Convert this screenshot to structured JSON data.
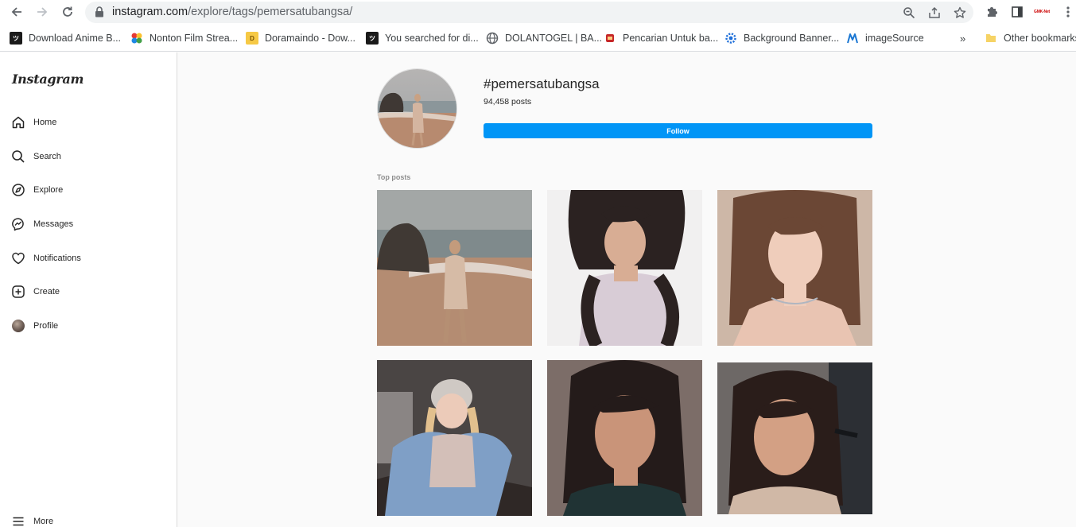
{
  "browser": {
    "url_host": "instagram.com",
    "url_path": "/explore/tags/pemersatubangsa/",
    "extension_badge": "GMK-Net",
    "bookmarks": [
      {
        "label": "Download Anime B...",
        "icon": "dark-page-icon"
      },
      {
        "label": "Nonton Film Strea...",
        "icon": "pinwheel-icon"
      },
      {
        "label": "Doramaindo - Dow...",
        "icon": "d-letter-icon",
        "icon_text": "D"
      },
      {
        "label": "You searched for di...",
        "icon": "dark-page-icon"
      },
      {
        "label": "DOLANTOGEL | BA...",
        "icon": "globe-icon"
      },
      {
        "label": "Pencarian Untuk ba...",
        "icon": "red-box-icon"
      },
      {
        "label": "Background Banner...",
        "icon": "gear-blue-icon"
      },
      {
        "label": "imageSource",
        "icon": "m-logo-icon"
      }
    ],
    "other_bookmarks": "Other bookmarks"
  },
  "sidebar": {
    "logo": "Instagram",
    "items": [
      {
        "label": "Home",
        "icon": "home-icon"
      },
      {
        "label": "Search",
        "icon": "search-icon"
      },
      {
        "label": "Explore",
        "icon": "compass-icon"
      },
      {
        "label": "Messages",
        "icon": "messenger-icon"
      },
      {
        "label": "Notifications",
        "icon": "heart-icon"
      },
      {
        "label": "Create",
        "icon": "plus-square-icon"
      },
      {
        "label": "Profile",
        "icon": "avatar"
      }
    ],
    "more": "More"
  },
  "tag": {
    "title": "#pemersatubangsa",
    "count": "94,458 posts",
    "follow": "Follow"
  },
  "top_posts_label": "Top posts",
  "colors": {
    "accent": "#0095f6",
    "page_bg": "#fafafa",
    "border": "#dbdbdb"
  }
}
